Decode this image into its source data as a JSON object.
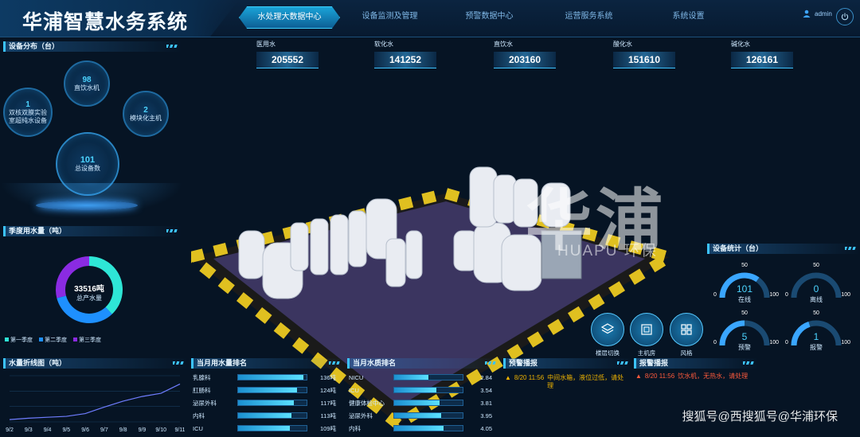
{
  "header": {
    "title": "华浦智慧水务系统",
    "user": "admin",
    "nav": [
      {
        "label": "水处理大数据中心",
        "active": true
      },
      {
        "label": "设备监测及管理",
        "active": false
      },
      {
        "label": "预警数据中心",
        "active": false
      },
      {
        "label": "运营服务系统",
        "active": false
      },
      {
        "label": "系统设置",
        "active": false
      }
    ]
  },
  "device_distribution": {
    "title": "设备分布（台）",
    "items": [
      {
        "value": "98",
        "label": "直饮水机"
      },
      {
        "value": "1",
        "label": "双核双膜实验 室超纯水设备"
      },
      {
        "value": "2",
        "label": "模块化主机"
      },
      {
        "value": "101",
        "label": "总设备数"
      }
    ]
  },
  "stats": [
    {
      "label": "医用水",
      "value": "205552"
    },
    {
      "label": "软化水",
      "value": "141252"
    },
    {
      "label": "直饮水",
      "value": "203160"
    },
    {
      "label": "酸化水",
      "value": "151610"
    },
    {
      "label": "碱化水",
      "value": "126161"
    }
  ],
  "quarter_usage": {
    "title": "季度用水量（吨）",
    "center_value": "33516吨",
    "center_label": "总产水量",
    "legend": [
      "第一季度",
      "第二季度",
      "第三季度"
    ],
    "colors": [
      "#2ee6d6",
      "#1e90ff",
      "#8a2be2"
    ]
  },
  "chart_data": {
    "type": "donut",
    "categories": [
      "第一季度",
      "第二季度",
      "第三季度"
    ],
    "values": [
      0.38,
      0.33,
      0.29
    ]
  },
  "line_chart": {
    "title": "水量折线图（吨）",
    "x": [
      "9/2",
      "9/3",
      "9/4",
      "9/5",
      "9/6",
      "9/7",
      "9/8",
      "9/9",
      "9/10",
      "9/11"
    ],
    "y": [
      0.05,
      0.08,
      0.1,
      0.12,
      0.18,
      0.32,
      0.45,
      0.55,
      0.62,
      0.82
    ]
  },
  "month_usage_rank": {
    "title": "当月用水量排名",
    "rows": [
      {
        "name": "乳腺科",
        "value": "136吨",
        "pct": 0.95
      },
      {
        "name": "肛肠科",
        "value": "124吨",
        "pct": 0.86
      },
      {
        "name": "泌尿外科",
        "value": "117吨",
        "pct": 0.81
      },
      {
        "name": "内科",
        "value": "113吨",
        "pct": 0.78
      },
      {
        "name": "ICU",
        "value": "109吨",
        "pct": 0.75
      }
    ]
  },
  "month_quality_rank": {
    "title": "当月水质排名",
    "rows": [
      {
        "name": "NICU",
        "value": "2.84",
        "pct": 0.5
      },
      {
        "name": "ICU",
        "value": "3.54",
        "pct": 0.62
      },
      {
        "name": "健康体检中心",
        "value": "3.81",
        "pct": 0.66
      },
      {
        "name": "泌尿外科",
        "value": "3.95",
        "pct": 0.69
      },
      {
        "name": "内科",
        "value": "4.05",
        "pct": 0.72
      }
    ]
  },
  "warning": {
    "title": "预警播报",
    "time": "8/20 11:56",
    "message": "中间水箱，液位过低，请处理"
  },
  "alarm": {
    "title": "报警播报",
    "time": "8/20 11:56",
    "message": "饮水机，无热水，请处理"
  },
  "device_stats": {
    "title": "设备统计（台）",
    "gauges": [
      {
        "value": "101",
        "label": "在线",
        "pct": 0.7,
        "min": "0",
        "mid": "50",
        "max": "100"
      },
      {
        "value": "0",
        "label": "离线",
        "pct": 0.0,
        "min": "0",
        "mid": "50",
        "max": "100"
      },
      {
        "value": "5",
        "label": "预警",
        "pct": 0.5,
        "min": "0",
        "mid": "50",
        "max": "100"
      },
      {
        "value": "1",
        "label": "报警",
        "pct": 0.4,
        "min": "0",
        "mid": "50",
        "max": "100"
      }
    ]
  },
  "scene_buttons": [
    {
      "label": "楼层切换",
      "icon": "layers-icon"
    },
    {
      "label": "主机房",
      "icon": "server-room-icon"
    },
    {
      "label": "风格",
      "icon": "style-grid-icon"
    }
  ],
  "brand": {
    "cn": "华浦",
    "en": "HUAPU 环保"
  },
  "watermark": "搜狐号@西搜狐号@华浦环保"
}
